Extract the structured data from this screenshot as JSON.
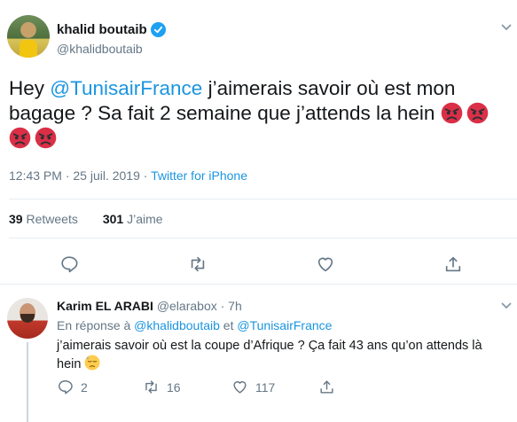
{
  "main_tweet": {
    "author": {
      "name": "khalid boutaib",
      "handle": "@khalidboutaib"
    },
    "text": {
      "before": "Hey ",
      "mention": "@TunisairFrance",
      "after": " j’aimerais savoir où est mon bagage ? Sa fait 2 semaine que j’attends la hein "
    },
    "emoji": "angry-face-emoji",
    "emoji_count": 4,
    "time": "12:43 PM · 25 juil. 2019 · ",
    "source": "Twitter for iPhone",
    "stats": {
      "retweets_count": "39",
      "retweets_label": "Retweets",
      "likes_count": "301",
      "likes_label": "J’aime"
    }
  },
  "reply": {
    "author": {
      "name": "Karim EL ARABI",
      "handle": "@elarabox · 7h"
    },
    "replying_to": {
      "prefix": "En réponse à ",
      "mention1": "@khalidboutaib",
      "sep": " et ",
      "mention2": "@TunisairFrance"
    },
    "text": "j’aimerais savoir où est la coupe d’Afrique ? Ça fait 43 ans qu’on attends là hein ",
    "emoji": "downcast-face-sweat-emoji",
    "actions": {
      "replies": "2",
      "retweets": "16",
      "likes": "117"
    }
  },
  "colors": {
    "link": "#1b95e0",
    "muted": "#657786",
    "verified": "#1da1f2",
    "divider": "#e6ecf0"
  }
}
